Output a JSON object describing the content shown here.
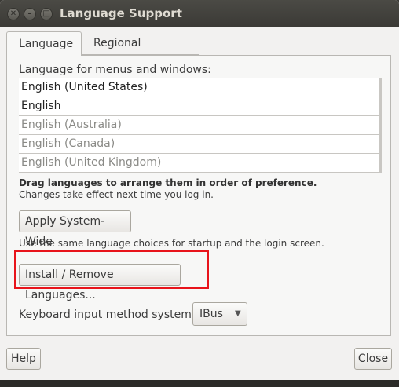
{
  "window": {
    "title": "Language Support",
    "controls": {
      "close": "✕",
      "minimize": "–",
      "maximize": "□"
    }
  },
  "tabs": [
    {
      "label": "Language",
      "active": true
    },
    {
      "label": "Regional Formats",
      "active": false
    }
  ],
  "language_tab": {
    "menus_label": "Language for menus and windows:",
    "languages": [
      {
        "name": "English (United States)",
        "enabled": true
      },
      {
        "name": "English",
        "enabled": true
      },
      {
        "name": "English (Australia)",
        "enabled": false
      },
      {
        "name": "English (Canada)",
        "enabled": false
      },
      {
        "name": "English (United Kingdom)",
        "enabled": false
      }
    ],
    "drag_hint": "Drag languages to arrange them in order of preference.",
    "effect_hint": "Changes take effect next time you log in.",
    "apply_button": "Apply System-Wide",
    "startup_hint": "Use the same language choices for startup and the login screen.",
    "install_button": "Install / Remove Languages...",
    "keyboard_label": "Keyboard input method system:",
    "keyboard_value": "IBus",
    "highlight_color": "#e8141b"
  },
  "footer": {
    "help_button": "Help",
    "close_button": "Close"
  }
}
